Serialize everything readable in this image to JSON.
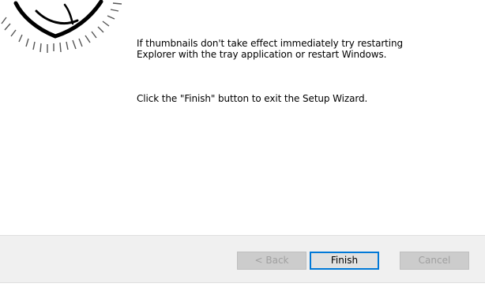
{
  "wizard": {
    "message_thumbnails": "If thumbnails don't take effect immediately try restarting\nExplorer with the tray application or restart Windows.",
    "message_finish": "Click the \"Finish\" button to exit the Setup Wizard."
  },
  "buttons": {
    "back_label": "< Back",
    "finish_label": "Finish",
    "cancel_label": "Cancel"
  },
  "icons": {
    "banner_art": "sketch-illustration-icon"
  }
}
